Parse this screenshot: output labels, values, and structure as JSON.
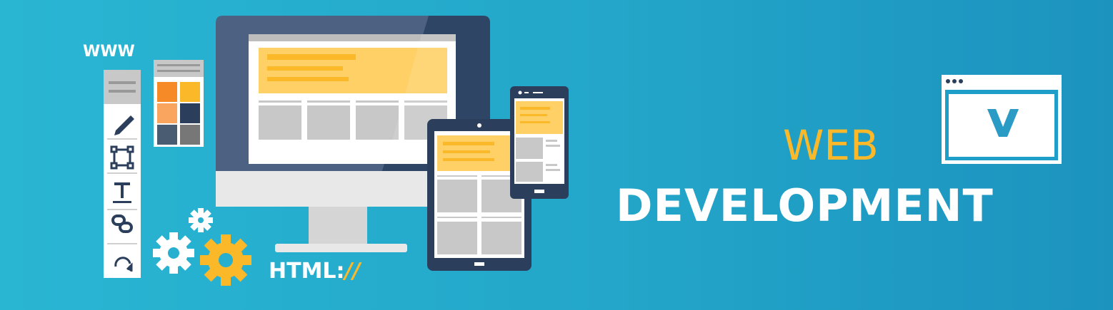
{
  "banner": {
    "www_label": "WWW",
    "html_label": "HTML:",
    "html_slashes": "//",
    "title_line1": "WEB",
    "title_line2": "DEVELOPMENT"
  },
  "icons": {
    "toolbar": [
      "pencil-icon",
      "transform-icon",
      "text-tool-icon",
      "link-icon",
      "rotate-icon"
    ],
    "gears": [
      "gear-icon",
      "gear-icon",
      "gear-icon"
    ],
    "browser_window": "browser-check-icon"
  },
  "colors": {
    "background_start": "#29b6d3",
    "background_end": "#1c93bf",
    "accent": "#fbb829",
    "navy": "#2b3f5c"
  }
}
